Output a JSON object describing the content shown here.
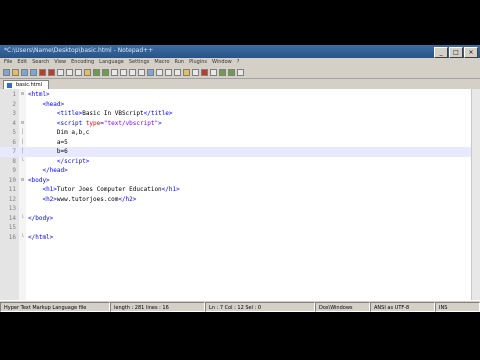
{
  "window": {
    "title": "*C:\\Users\\Name\\Desktop\\basic.html - Notepad++"
  },
  "menu": [
    "File",
    "Edit",
    "Search",
    "View",
    "Encoding",
    "Language",
    "Settings",
    "Macro",
    "Run",
    "Plugins",
    "Window",
    "?"
  ],
  "tab": {
    "label": "basic.html"
  },
  "editor": {
    "current_line": 7,
    "lines": [
      {
        "n": "1",
        "fold": "⊟",
        "html": "<span class=\"t\">&lt;html&gt;</span>"
      },
      {
        "n": "2",
        "fold": "",
        "html": "    <span class=\"t\">&lt;head&gt;</span>"
      },
      {
        "n": "3",
        "fold": "",
        "html": "        <span class=\"t\">&lt;title&gt;</span><span class=\"x\">Basic In VBScript</span><span class=\"t\">&lt;/title&gt;</span>"
      },
      {
        "n": "4",
        "fold": "⊟",
        "html": "        <span class=\"t\">&lt;script </span><span class=\"a\">type</span><span class=\"t\">=</span><span class=\"s\">\"text/vbscript\"</span><span class=\"t\">&gt;</span>"
      },
      {
        "n": "5",
        "fold": "│",
        "html": "        <span class=\"x\">Dim a,b,c</span>"
      },
      {
        "n": "6",
        "fold": "│",
        "html": "        <span class=\"x\">a=5</span>"
      },
      {
        "n": "7",
        "fold": "│",
        "html": "        <span class=\"x\">b=6</span>"
      },
      {
        "n": "8",
        "fold": "└",
        "html": "        <span class=\"t\">&lt;/script&gt;</span>"
      },
      {
        "n": "9",
        "fold": "",
        "html": "    <span class=\"t\">&lt;/head&gt;</span>"
      },
      {
        "n": "10",
        "fold": "⊟",
        "html": "<span class=\"t\">&lt;body&gt;</span>"
      },
      {
        "n": "11",
        "fold": "",
        "html": "    <span class=\"t\">&lt;h1&gt;</span><span class=\"x\">Tutor Joes Computer Education</span><span class=\"t\">&lt;/h1&gt;</span>"
      },
      {
        "n": "12",
        "fold": "",
        "html": "    <span class=\"t\">&lt;h2&gt;</span><span class=\"x\">www.tutorjoes.com</span><span class=\"t\">&lt;/h2&gt;</span>"
      },
      {
        "n": "13",
        "fold": "",
        "html": ""
      },
      {
        "n": "14",
        "fold": "└",
        "html": "<span class=\"t\">&lt;/body&gt;</span>"
      },
      {
        "n": "15",
        "fold": "",
        "html": ""
      },
      {
        "n": "16",
        "fold": "└",
        "html": "<span class=\"t\">&lt;/html&gt;</span>"
      }
    ]
  },
  "status": {
    "type": "Hyper Text Markup Language file",
    "length": "length : 281    lines : 16",
    "position": "Ln : 7    Col : 12    Sel : 0",
    "eol": "Dos\\Windows",
    "encoding": "ANSI as UTF-8",
    "mode": "INS"
  },
  "colors": {
    "tag": "#0000ff",
    "attribute": "#ff0000",
    "string": "#8000ff",
    "current_line": "#e8e8ff"
  }
}
